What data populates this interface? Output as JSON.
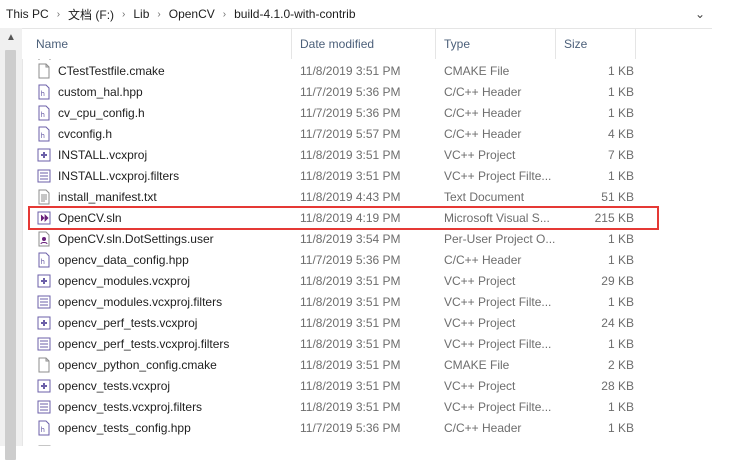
{
  "address_bar": {
    "crumbs": [
      "This PC",
      "文档 (F:)",
      "Lib",
      "OpenCV",
      "build-4.1.0-with-contrib"
    ],
    "dropdown_icon": "chevron-down-icon"
  },
  "columns": {
    "name": "Name",
    "date": "Date modified",
    "type": "Type",
    "size": "Size"
  },
  "files": [
    {
      "name": "CTestTestfile.cmake",
      "date": "11/8/2019 3:51 PM",
      "type": "CMAKE File",
      "size": "1 KB",
      "icon": "cmake-file-icon"
    },
    {
      "name": "custom_hal.hpp",
      "date": "11/7/2019 5:36 PM",
      "type": "C/C++ Header",
      "size": "1 KB",
      "icon": "cpp-header-icon"
    },
    {
      "name": "cv_cpu_config.h",
      "date": "11/7/2019 5:36 PM",
      "type": "C/C++ Header",
      "size": "1 KB",
      "icon": "cpp-header-icon"
    },
    {
      "name": "cvconfig.h",
      "date": "11/7/2019 5:57 PM",
      "type": "C/C++ Header",
      "size": "4 KB",
      "icon": "cpp-header-icon"
    },
    {
      "name": "INSTALL.vcxproj",
      "date": "11/8/2019 3:51 PM",
      "type": "VC++ Project",
      "size": "7 KB",
      "icon": "vcxproj-icon"
    },
    {
      "name": "INSTALL.vcxproj.filters",
      "date": "11/8/2019 3:51 PM",
      "type": "VC++ Project Filte...",
      "size": "1 KB",
      "icon": "vcxproj-filters-icon"
    },
    {
      "name": "install_manifest.txt",
      "date": "11/8/2019 4:43 PM",
      "type": "Text Document",
      "size": "51 KB",
      "icon": "text-file-icon"
    },
    {
      "name": "OpenCV.sln",
      "date": "11/8/2019 4:19 PM",
      "type": "Microsoft Visual S...",
      "size": "215 KB",
      "icon": "visual-studio-solution-icon"
    },
    {
      "name": "OpenCV.sln.DotSettings.user",
      "date": "11/8/2019 3:54 PM",
      "type": "Per-User Project O...",
      "size": "1 KB",
      "icon": "user-settings-icon"
    },
    {
      "name": "opencv_data_config.hpp",
      "date": "11/7/2019 5:36 PM",
      "type": "C/C++ Header",
      "size": "1 KB",
      "icon": "cpp-header-icon"
    },
    {
      "name": "opencv_modules.vcxproj",
      "date": "11/8/2019 3:51 PM",
      "type": "VC++ Project",
      "size": "29 KB",
      "icon": "vcxproj-icon"
    },
    {
      "name": "opencv_modules.vcxproj.filters",
      "date": "11/8/2019 3:51 PM",
      "type": "VC++ Project Filte...",
      "size": "1 KB",
      "icon": "vcxproj-filters-icon"
    },
    {
      "name": "opencv_perf_tests.vcxproj",
      "date": "11/8/2019 3:51 PM",
      "type": "VC++ Project",
      "size": "24 KB",
      "icon": "vcxproj-icon"
    },
    {
      "name": "opencv_perf_tests.vcxproj.filters",
      "date": "11/8/2019 3:51 PM",
      "type": "VC++ Project Filte...",
      "size": "1 KB",
      "icon": "vcxproj-filters-icon"
    },
    {
      "name": "opencv_python_config.cmake",
      "date": "11/8/2019 3:51 PM",
      "type": "CMAKE File",
      "size": "2 KB",
      "icon": "cmake-file-icon"
    },
    {
      "name": "opencv_tests.vcxproj",
      "date": "11/8/2019 3:51 PM",
      "type": "VC++ Project",
      "size": "28 KB",
      "icon": "vcxproj-icon"
    },
    {
      "name": "opencv_tests.vcxproj.filters",
      "date": "11/8/2019 3:51 PM",
      "type": "VC++ Project Filte...",
      "size": "1 KB",
      "icon": "vcxproj-filters-icon"
    },
    {
      "name": "opencv_tests_config.hpp",
      "date": "11/7/2019 5:36 PM",
      "type": "C/C++ Header",
      "size": "1 KB",
      "icon": "cpp-header-icon"
    }
  ],
  "highlighted_file": "OpenCV.sln",
  "highlight_color": "#e53935"
}
